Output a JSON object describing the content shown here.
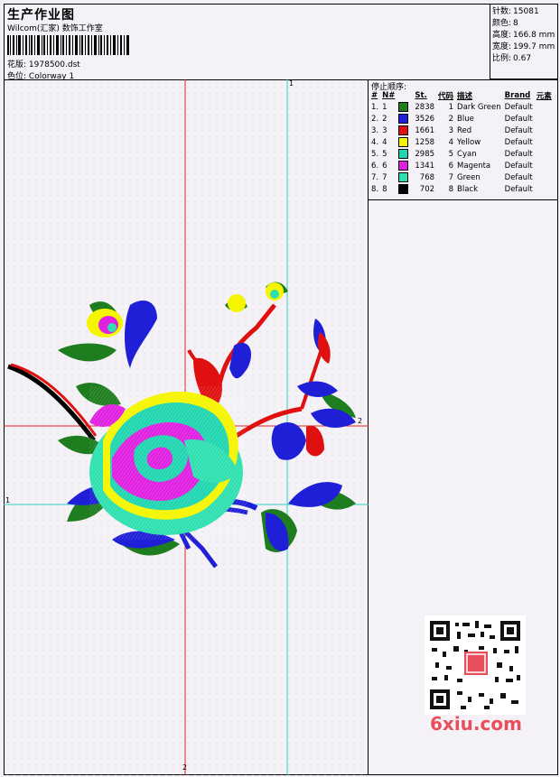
{
  "header": {
    "title": "生产作业图",
    "company": "Wilcom(汇家) 数饰工作室",
    "pattern_label": "花版:",
    "pattern_value": "1978500.dst",
    "colorway_label": "色位:",
    "colorway_value": "Colorway 1"
  },
  "info": {
    "stitches_label": "针数:",
    "stitches_value": "15081",
    "colors_label": "颜色:",
    "colors_value": "8",
    "height_label": "高度:",
    "height_value": "166.8 mm",
    "width_label": "宽度:",
    "width_value": "199.7 mm",
    "scale_label": "比例:",
    "scale_value": "0.67"
  },
  "legend": {
    "title": "停止顺序:",
    "headers": {
      "idx": "#",
      "no": "N#",
      "st": "St.",
      "code": "代码",
      "desc": "描述",
      "brand": "Brand",
      "elem": "元素"
    },
    "rows": [
      {
        "idx": "1.",
        "no": "1",
        "color": "#1e7d1e",
        "st": "2838",
        "code": "1",
        "desc": "Dark Green",
        "brand": "Default"
      },
      {
        "idx": "2.",
        "no": "2",
        "color": "#1f1fd8",
        "st": "3526",
        "code": "2",
        "desc": "Blue",
        "brand": "Default"
      },
      {
        "idx": "3.",
        "no": "3",
        "color": "#e01010",
        "st": "1661",
        "code": "3",
        "desc": "Red",
        "brand": "Default"
      },
      {
        "idx": "4.",
        "no": "4",
        "color": "#f5f500",
        "st": "1258",
        "code": "4",
        "desc": "Yellow",
        "brand": "Default"
      },
      {
        "idx": "5.",
        "no": "5",
        "color": "#20d6b0",
        "st": "2985",
        "code": "5",
        "desc": "Cyan",
        "brand": "Default"
      },
      {
        "idx": "6.",
        "no": "6",
        "color": "#e020e0",
        "st": "1341",
        "code": "6",
        "desc": "Magenta",
        "brand": "Default"
      },
      {
        "idx": "7.",
        "no": "7",
        "color": "#2ee0b0",
        "st": "768",
        "code": "7",
        "desc": "Green",
        "brand": "Default"
      },
      {
        "idx": "8.",
        "no": "8",
        "color": "#000000",
        "st": "702",
        "code": "8",
        "desc": "Black",
        "brand": "Default"
      }
    ]
  },
  "guides": {
    "v_red": "2",
    "h_red": "2",
    "v_cyan": "1",
    "h_cyan": "1"
  },
  "watermark": "6xiu.com"
}
